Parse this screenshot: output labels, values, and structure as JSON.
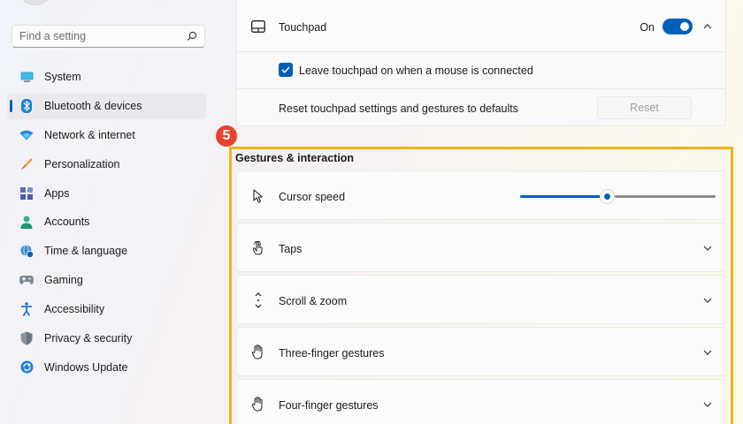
{
  "search": {
    "placeholder": "Find a setting"
  },
  "sidebar": {
    "items": [
      {
        "label": "System",
        "icon": "system-icon",
        "selected": false
      },
      {
        "label": "Bluetooth & devices",
        "icon": "bluetooth-icon",
        "selected": true
      },
      {
        "label": "Network & internet",
        "icon": "wifi-icon",
        "selected": false
      },
      {
        "label": "Personalization",
        "icon": "brush-icon",
        "selected": false
      },
      {
        "label": "Apps",
        "icon": "apps-icon",
        "selected": false
      },
      {
        "label": "Accounts",
        "icon": "person-icon",
        "selected": false
      },
      {
        "label": "Time & language",
        "icon": "globe-clock-icon",
        "selected": false
      },
      {
        "label": "Gaming",
        "icon": "gamepad-icon",
        "selected": false
      },
      {
        "label": "Accessibility",
        "icon": "accessibility-icon",
        "selected": false
      },
      {
        "label": "Privacy & security",
        "icon": "shield-icon",
        "selected": false
      },
      {
        "label": "Windows Update",
        "icon": "update-icon",
        "selected": false
      }
    ]
  },
  "touchpad": {
    "label": "Touchpad",
    "toggle_state": "On",
    "leave_on_label": "Leave touchpad on when a mouse is connected",
    "leave_on_checked": true,
    "reset_label": "Reset touchpad settings and gestures to defaults",
    "reset_button": "Reset"
  },
  "annotation": {
    "badge": "5"
  },
  "gestures": {
    "title": "Gestures & interaction",
    "cursor_speed": {
      "label": "Cursor speed",
      "value_fraction": 0.45
    },
    "rows": [
      {
        "label": "Taps",
        "icon": "tap-icon"
      },
      {
        "label": "Scroll & zoom",
        "icon": "scroll-icon"
      },
      {
        "label": "Three-finger gestures",
        "icon": "hand-icon"
      },
      {
        "label": "Four-finger gestures",
        "icon": "hand-icon"
      }
    ]
  },
  "colors": {
    "accent": "#005fb8",
    "badge": "#e8432c",
    "highlight": "#f2b315"
  }
}
